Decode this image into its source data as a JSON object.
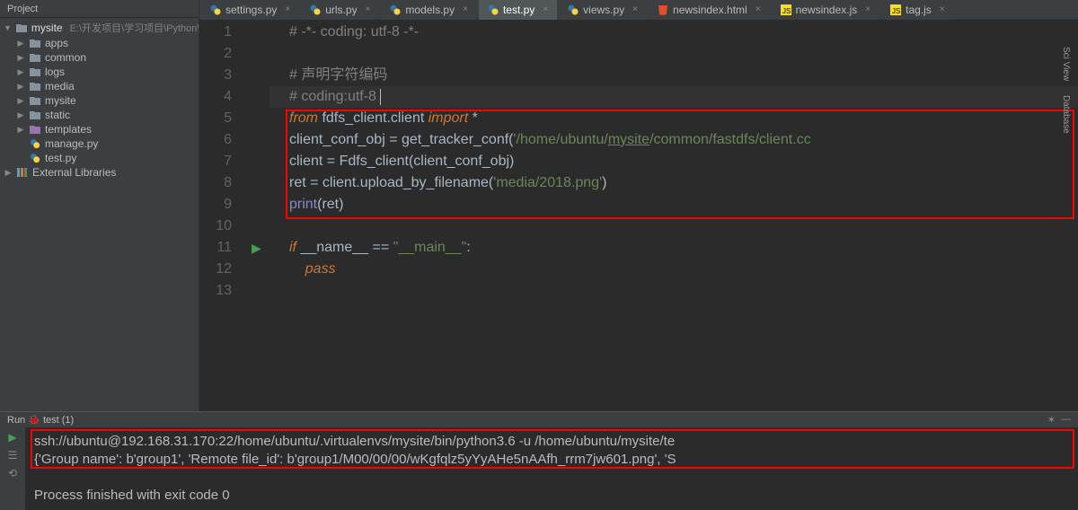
{
  "sidebar": {
    "titleIcon": "project-icon",
    "title": "Project",
    "root": {
      "name": "mysite",
      "path": "E:\\开发项目\\学习项目\\Python\\my"
    },
    "items": [
      {
        "arrow": "▶",
        "type": "folder",
        "name": "apps"
      },
      {
        "arrow": "▶",
        "type": "folder",
        "name": "common"
      },
      {
        "arrow": "▶",
        "type": "folder",
        "name": "logs"
      },
      {
        "arrow": "▶",
        "type": "folder",
        "name": "media"
      },
      {
        "arrow": "▶",
        "type": "folder",
        "name": "mysite"
      },
      {
        "arrow": "▶",
        "type": "folder",
        "name": "static"
      },
      {
        "arrow": "▶",
        "type": "folder-tpl",
        "name": "templates"
      },
      {
        "arrow": "",
        "type": "pyfile",
        "name": "manage.py"
      },
      {
        "arrow": "",
        "type": "pyfile",
        "name": "test.py"
      }
    ],
    "ext": "External Libraries"
  },
  "tabs": [
    {
      "icon": "py",
      "name": "settings.py",
      "active": false
    },
    {
      "icon": "py",
      "name": "urls.py",
      "active": false
    },
    {
      "icon": "py",
      "name": "models.py",
      "active": false
    },
    {
      "icon": "py",
      "name": "test.py",
      "active": true
    },
    {
      "icon": "py",
      "name": "views.py",
      "active": false
    },
    {
      "icon": "html",
      "name": "newsindex.html",
      "active": false
    },
    {
      "icon": "js",
      "name": "newsindex.js",
      "active": false
    },
    {
      "icon": "js",
      "name": "tag.js",
      "active": false
    }
  ],
  "code": {
    "linecount": 13,
    "l1_comment": "# -*- coding: utf-8 -*-",
    "l3_comment": "# 声明字符编码",
    "l4_comment": "# coding:utf-8 ",
    "l5_from": "from",
    "l5_mod": " fdfs_client.client ",
    "l5_import": "import",
    "l5_star": " *",
    "l6_a": "client_conf_obj ",
    "l6_eq": "=",
    "l6_b": " get_tracker_conf(",
    "l6_s1": "'/home/ubuntu/",
    "l6_s2": "mysite",
    "l6_s3": "/common/fastdfs/client.cc",
    "l7_a": "client ",
    "l7_eq": "=",
    "l7_b": " Fdfs_client(client_conf_obj)",
    "l8_a": "ret ",
    "l8_eq": "=",
    "l8_b": " client.upload_by_filename(",
    "l8_s": "'media/2018.png'",
    "l8_c": ")",
    "l9_a": "print",
    "l9_b": "(ret)",
    "l11_if": "if",
    "l11_a": " __name__ ",
    "l11_eq": "==",
    "l11_s": " \"__main__\"",
    "l11_c": ":",
    "l12_pass": "pass"
  },
  "console": {
    "title": "Run 🐞 test (1)",
    "out1": "ssh://ubuntu@192.168.31.170:22/home/ubuntu/.virtualenvs/mysite/bin/python3.6 -u /home/ubuntu/mysite/te",
    "out2": "{'Group name': b'group1', 'Remote file_id': b'group1/M00/00/00/wKgfqlz5yYyAHe5nAAfh_rrm7jw601.png', 'S",
    "out3": "Process finished with exit code 0"
  },
  "rightTabs": [
    "Sci View",
    "Database"
  ]
}
